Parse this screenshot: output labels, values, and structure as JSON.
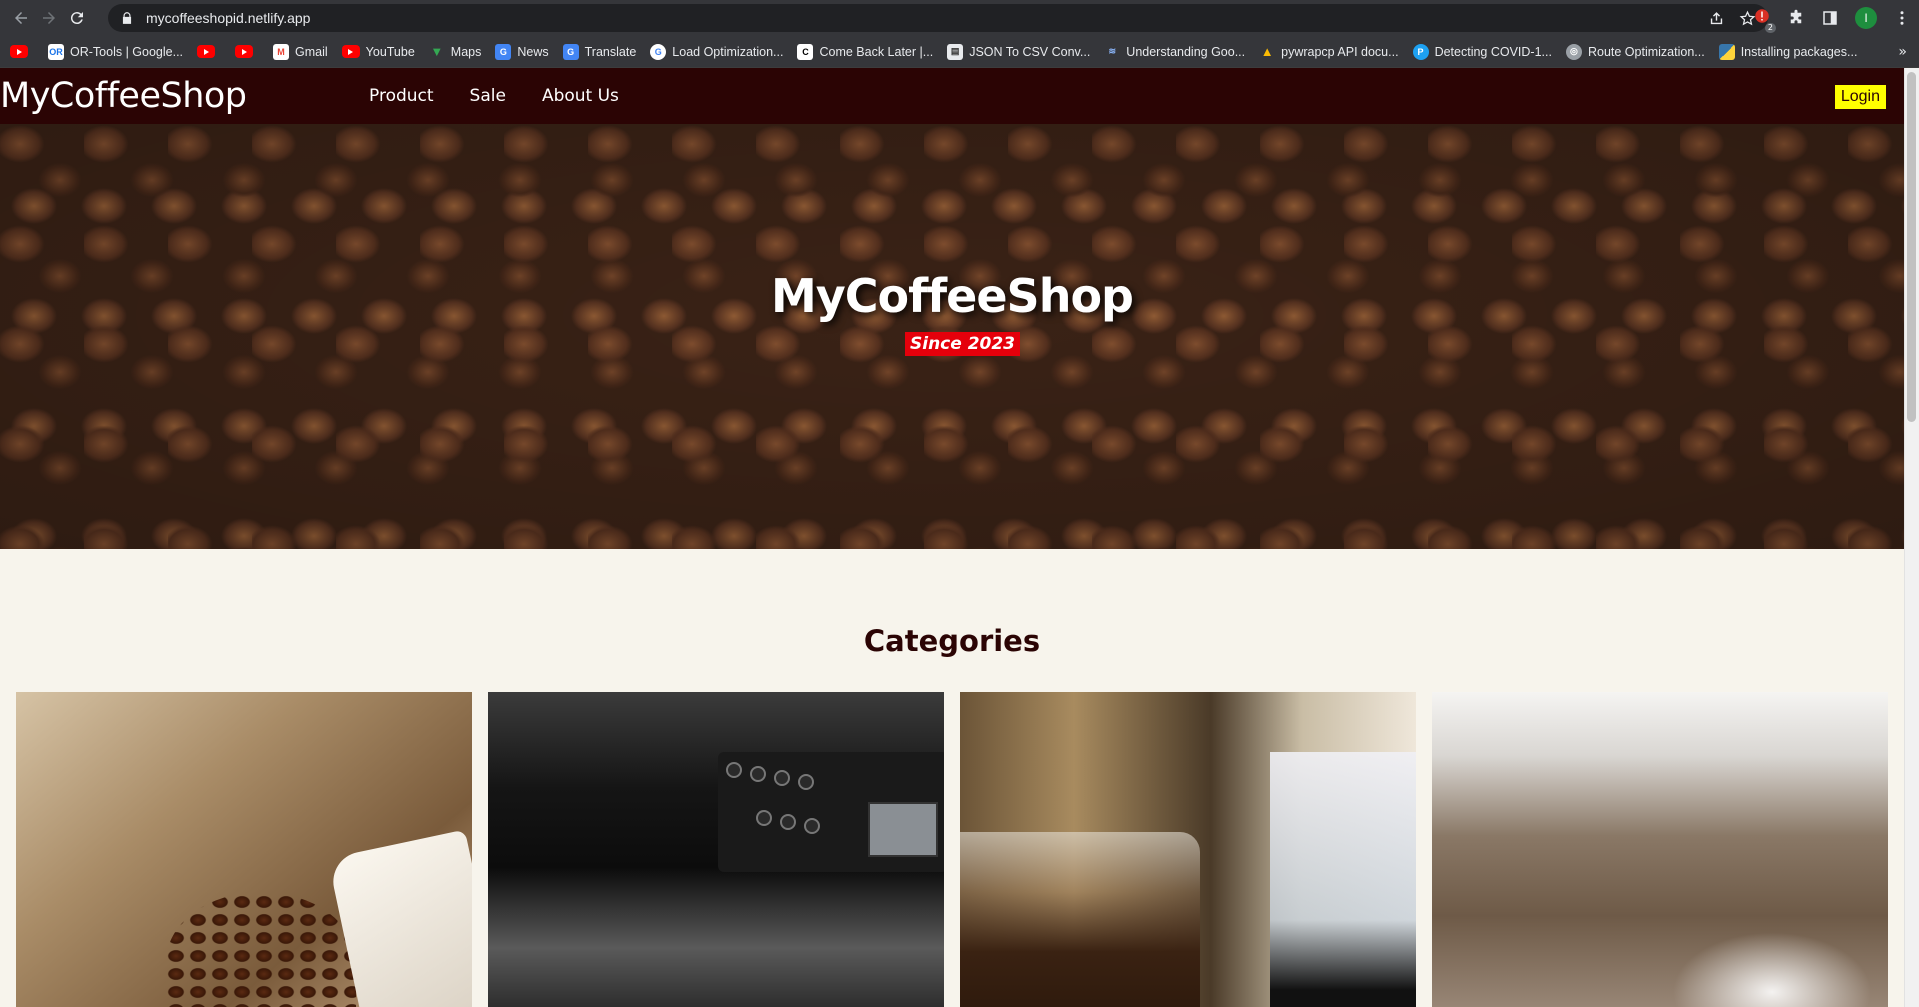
{
  "browser": {
    "url": "mycoffeeshopid.netlify.app",
    "extension_badge_count": "2",
    "profile_initial": "I",
    "bookmarks": [
      {
        "label": "",
        "icon": "youtube-icon"
      },
      {
        "label": "OR-Tools  |  Google...",
        "icon": "or-tools-icon"
      },
      {
        "label": "",
        "icon": "youtube-icon"
      },
      {
        "label": "",
        "icon": "youtube-icon"
      },
      {
        "label": "Gmail",
        "icon": "gmail-icon"
      },
      {
        "label": "YouTube",
        "icon": "youtube-icon"
      },
      {
        "label": "Maps",
        "icon": "maps-icon"
      },
      {
        "label": "News",
        "icon": "news-icon"
      },
      {
        "label": "Translate",
        "icon": "translate-icon"
      },
      {
        "label": "Load Optimization...",
        "icon": "google-icon"
      },
      {
        "label": "Come Back Later |...",
        "icon": "c-icon"
      },
      {
        "label": "JSON To CSV Conv...",
        "icon": "document-icon"
      },
      {
        "label": "Understanding Goo...",
        "icon": "bookmark-site-icon"
      },
      {
        "label": "pywrapcp API docu...",
        "icon": "drive-icon"
      },
      {
        "label": "Detecting COVID-1...",
        "icon": "p-icon"
      },
      {
        "label": "Route Optimization...",
        "icon": "globe-icon"
      },
      {
        "label": "Installing packages...",
        "icon": "python-icon"
      }
    ]
  },
  "site": {
    "logo": "MyCoffeeShop",
    "nav": [
      "Product",
      "Sale",
      "About Us"
    ],
    "login_label": "Login",
    "hero_title": "MyCoffeeShop",
    "hero_badge": "Since 2023",
    "section_title": "Categories",
    "categories": [
      {
        "image": "coffee-beans-sack-photo"
      },
      {
        "image": "espresso-machine-photo"
      },
      {
        "image": "coffee-grinder-photo"
      },
      {
        "image": "steaming-coffee-photo"
      }
    ]
  },
  "colors": {
    "nav_bg": "#2b0404",
    "login_bg": "#ffff00",
    "badge_bg": "#e5000b",
    "page_bg": "#f7f4ec"
  }
}
